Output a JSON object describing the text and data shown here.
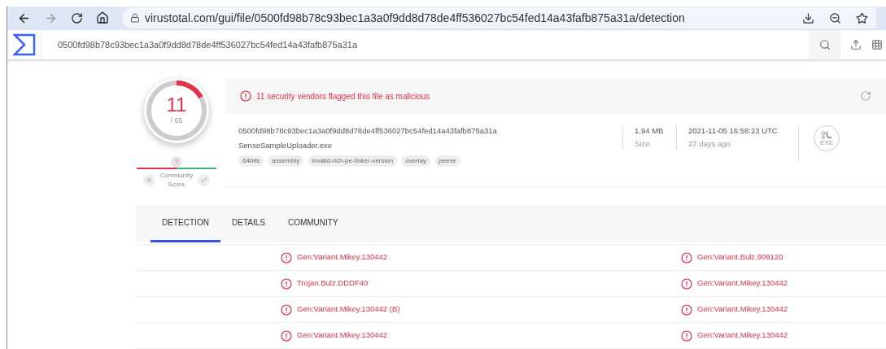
{
  "browser": {
    "url": "virustotal.com/gui/file/0500fd98b78c93bec1a3a0f9dd8d78de4ff536027bc54fed14a43fafb875a31a/detection"
  },
  "header": {
    "search_value": "0500fd98b78c93bec1a3a0f9dd8d78de4ff536027bc54fed14a43fafb875a31a"
  },
  "score": {
    "detections": "11",
    "total": "/ 65",
    "level": 0.17,
    "community_help": "?",
    "community_label": "Community Score"
  },
  "summary": {
    "alert": "11 security vendors flagged this file as malicious",
    "hash": "0500fd98b78c93bec1a3a0f9dd8d78de4ff536027bc54fed14a43fafb875a31a",
    "filename": "SenseSampleUploader.exe",
    "tags": [
      "64bits",
      "assembly",
      "invalid-rich-pe-linker-version",
      "overlay",
      "peexe"
    ],
    "size": "1.94 MB",
    "size_label": "Size",
    "date": "2021-11-05 16:58:23 UTC",
    "date_ago": "27 days ago",
    "file_type": "EXE"
  },
  "tabs": [
    {
      "label": "DETECTION",
      "selected": true
    },
    {
      "label": "DETAILS",
      "selected": false
    },
    {
      "label": "COMMUNITY",
      "selected": false
    }
  ],
  "detections": [
    [
      "Gen:Variant.Mikey.130442",
      "Gen:Variant.Bulz.909120"
    ],
    [
      "Trojan.Bulz.DDDF40",
      "Gen:Variant.Mikey.130442"
    ],
    [
      "Gen:Variant.Mikey.130442 (B)",
      "Gen:Variant.Mikey.130442"
    ],
    [
      "Gen:Variant.Mikey.130442",
      "Gen:Variant.Mikey.130442"
    ]
  ]
}
